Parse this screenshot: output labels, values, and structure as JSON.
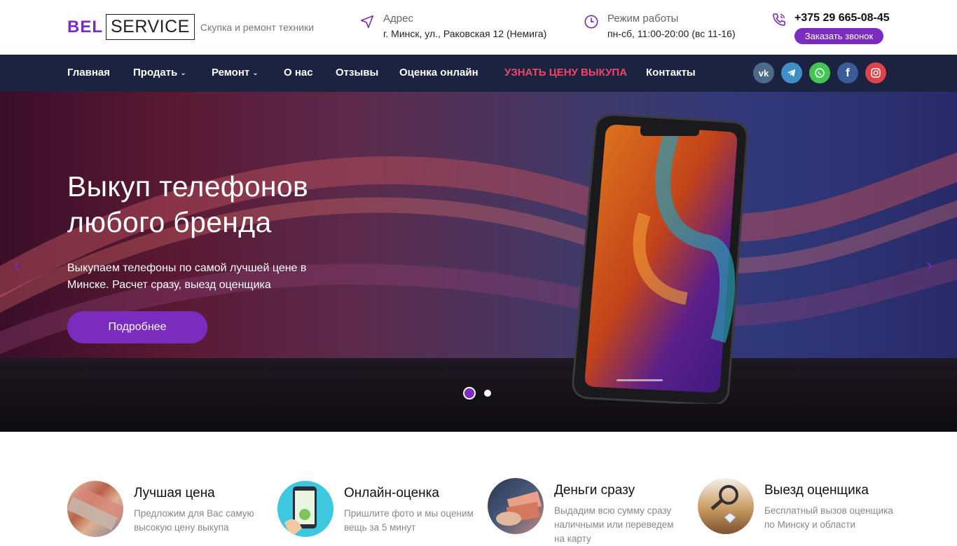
{
  "logo": {
    "bel": "BEL",
    "service": "SERVICE"
  },
  "tagline": "Скупка и ремонт техники",
  "address": {
    "title": "Адрес",
    "value": "г. Минск, ул., Раковская 12 (Немига)"
  },
  "hours": {
    "title": "Режим работы",
    "value": "пн-сб, 11:00-20:00 (вс 11-16)"
  },
  "contact": {
    "phone": "+375 29 665-08-45",
    "callback": "Заказать звонок"
  },
  "nav": {
    "items": [
      "Главная",
      "Продать",
      "Ремонт",
      "О нас",
      "Отзывы",
      "Оценка онлайн",
      "УЗНАТЬ ЦЕНУ ВЫКУПА",
      "Контакты"
    ]
  },
  "social": {
    "vk": "vk",
    "telegram": "telegram-icon",
    "whatsapp": "whatsapp-icon",
    "facebook": "f",
    "instagram": "instagram-icon"
  },
  "hero": {
    "title": "Выкуп телефонов любого бренда",
    "text": "Выкупаем телефоны по самой лучшей цене в Минске.  Расчет сразу, выезд оценщика",
    "button": "Подробнее",
    "prev": "‹",
    "next": "›"
  },
  "features": [
    {
      "title": "Лучшая цена",
      "desc": "Предложим для Вас самую высокую цену выкупа"
    },
    {
      "title": "Онлайн-оценка",
      "desc": "Пришлите фото и мы оценим вещь за 5 минут"
    },
    {
      "title": "Деньги сразу",
      "desc": "Выдадим всю сумму сразу наличными или переведем на карту"
    },
    {
      "title": "Выезд оценщика",
      "desc": "Бесплатный вызов оценщика по Минску и области"
    }
  ],
  "colors": {
    "accent": "#7b2cbf",
    "nav_bg": "#1c2340",
    "highlight": "#ef4566"
  }
}
